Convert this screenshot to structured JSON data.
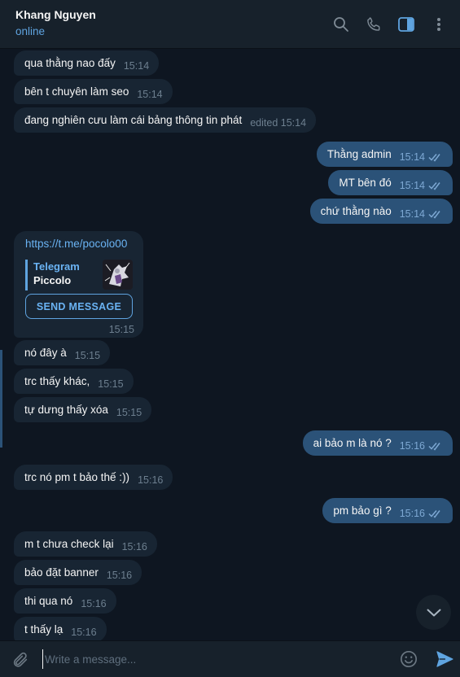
{
  "header": {
    "name": "Khang Nguyen",
    "status": "online"
  },
  "messages": [
    {
      "dir": "in",
      "text": "qua thằng nao đấy",
      "time": "15:14"
    },
    {
      "dir": "in",
      "text": "bên t chuyên làm seo",
      "time": "15:14"
    },
    {
      "dir": "in",
      "text": "đang nghiên cưu làm cái bảng thông tin phát",
      "time": "edited 15:14"
    },
    {
      "dir": "out",
      "text": "Thằng admin",
      "time": "15:14"
    },
    {
      "dir": "out",
      "text": "MT bên đó",
      "time": "15:14"
    },
    {
      "dir": "out",
      "text": "chứ thằng nào",
      "time": "15:14"
    },
    {
      "dir": "in",
      "text": "nó đây à",
      "time": "15:15"
    },
    {
      "dir": "in",
      "text": "trc thấy khác,",
      "time": "15:15"
    },
    {
      "dir": "in",
      "text": "tự dưng thấy xóa",
      "time": "15:15"
    },
    {
      "dir": "out",
      "text": "ai bảo m là nó ?",
      "time": "15:16"
    },
    {
      "dir": "in",
      "text": "trc nó pm t bảo thế :))",
      "time": "15:16"
    },
    {
      "dir": "out",
      "text": "pm bảo gì ?",
      "time": "15:16"
    },
    {
      "dir": "in",
      "text": "m t chưa check lại",
      "time": "15:16"
    },
    {
      "dir": "in",
      "text": "bảo đặt banner",
      "time": "15:16"
    },
    {
      "dir": "in",
      "text": "thi qua nó",
      "time": "15:16"
    },
    {
      "dir": "in",
      "text": "t thấy lạ",
      "time": "15:16"
    }
  ],
  "link_message": {
    "url": "https://t.me/pocolo00",
    "site": "Telegram",
    "title": "Piccolo",
    "button": "SEND MESSAGE",
    "time": "15:15"
  },
  "composer": {
    "placeholder": "Write a message..."
  },
  "colors": {
    "background": "#0e1621",
    "incoming_bubble": "#182533",
    "outgoing_bubble": "#2b5278",
    "accent": "#5fa4e0"
  }
}
